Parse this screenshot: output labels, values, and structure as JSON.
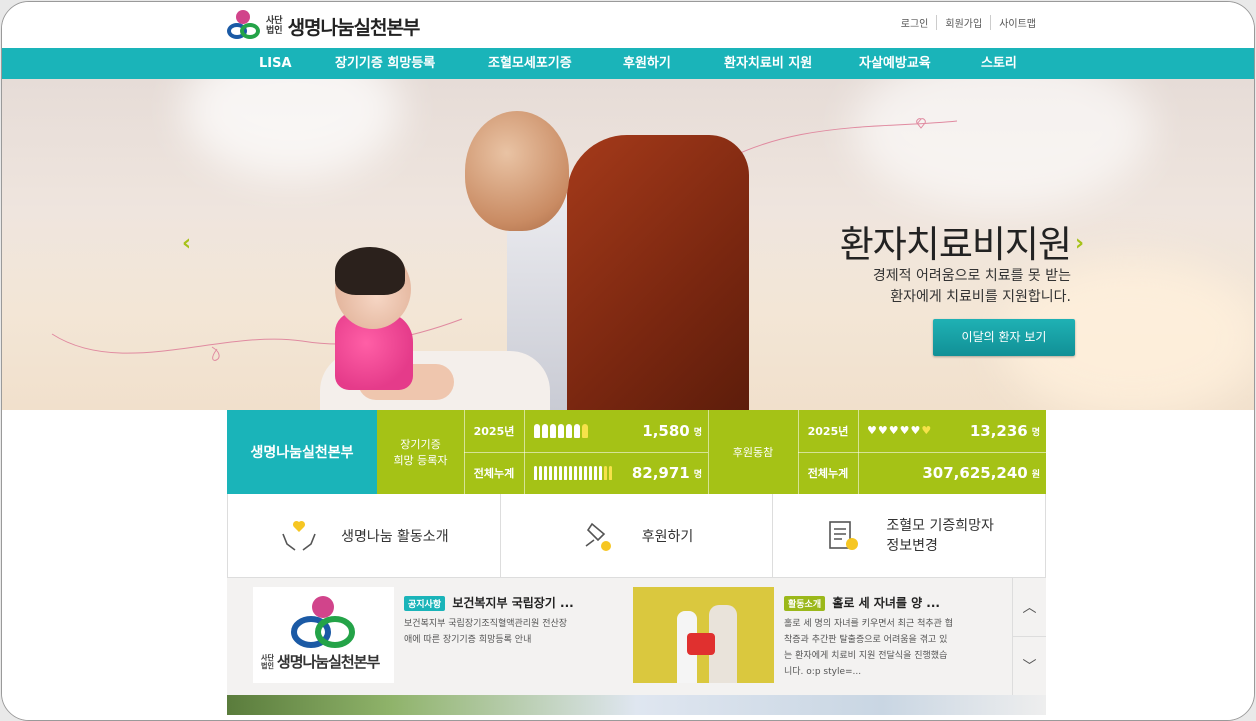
{
  "header": {
    "logo_corp_line1": "사단",
    "logo_corp_line2": "법인",
    "logo_name": "생명나눔실천본부",
    "util_links": [
      "로그인",
      "회원가입",
      "사이트맵"
    ]
  },
  "nav": {
    "items": [
      "LISA",
      "장기기증 희망등록",
      "조혈모세포기증",
      "후원하기",
      "환자치료비 지원",
      "자살예방교육",
      "스토리"
    ]
  },
  "hero": {
    "title": "환자치료비지원",
    "desc_line1": "경제적 어려움으로 치료를 못 받는",
    "desc_line2": "환자에게 치료비를 지원합니다.",
    "button": "이달의 환자 보기",
    "prev_arrow": "‹",
    "next_arrow": "›"
  },
  "stats": {
    "brand": "생명나눔실천본부",
    "left_label_1": "장기기증",
    "left_label_2": "희망 등록자",
    "year_label": "2025년",
    "total_label": "전체누계",
    "registrants_year": "1,580",
    "registrants_total": "82,971",
    "unit_person": "명",
    "right_label": "후원동참",
    "supporters_year": "13,236",
    "supporters_total": "307,625,240",
    "unit_won": "원"
  },
  "quick_links": [
    {
      "label": "생명나눔 활동소개",
      "icon": "hands-heart-icon"
    },
    {
      "label": "후원하기",
      "icon": "giving-hand-icon"
    },
    {
      "label_line1": "조혈모 기증희망자",
      "label_line2": "정보변경",
      "icon": "document-gear-icon"
    }
  ],
  "news": {
    "item1": {
      "tag": "공지사항",
      "title": "보건복지부 국립장기 ...",
      "desc_line1": "보건복지부 국립장기조직혈액관리원 전산장",
      "desc_line2": "애에 따른 장기기증 희망등록 안내",
      "thumb_logo_corp_line1": "사단",
      "thumb_logo_corp_line2": "법인",
      "thumb_logo_name": "생명나눔실천본부"
    },
    "item2": {
      "tag": "활동소개",
      "title": "홀로 세 자녀를 양 ...",
      "desc_line1": "홀로 세 명의 자녀를 키우면서 최근 척추관 협",
      "desc_line2": "착증과 추간판 탈출증으로 어려움을 겪고 있",
      "desc_line3": "는 환자에게 치료비 지원 전달식을 진행했습",
      "desc_line4": "니다. o:p style=..."
    },
    "up_arrow": "︿",
    "down_arrow": "﹀"
  },
  "colors": {
    "teal": "#1ab4b9",
    "lime": "#a5c216",
    "logo_pink": "#d1448b",
    "logo_blue": "#1b5aa5",
    "logo_green": "#24a348"
  }
}
